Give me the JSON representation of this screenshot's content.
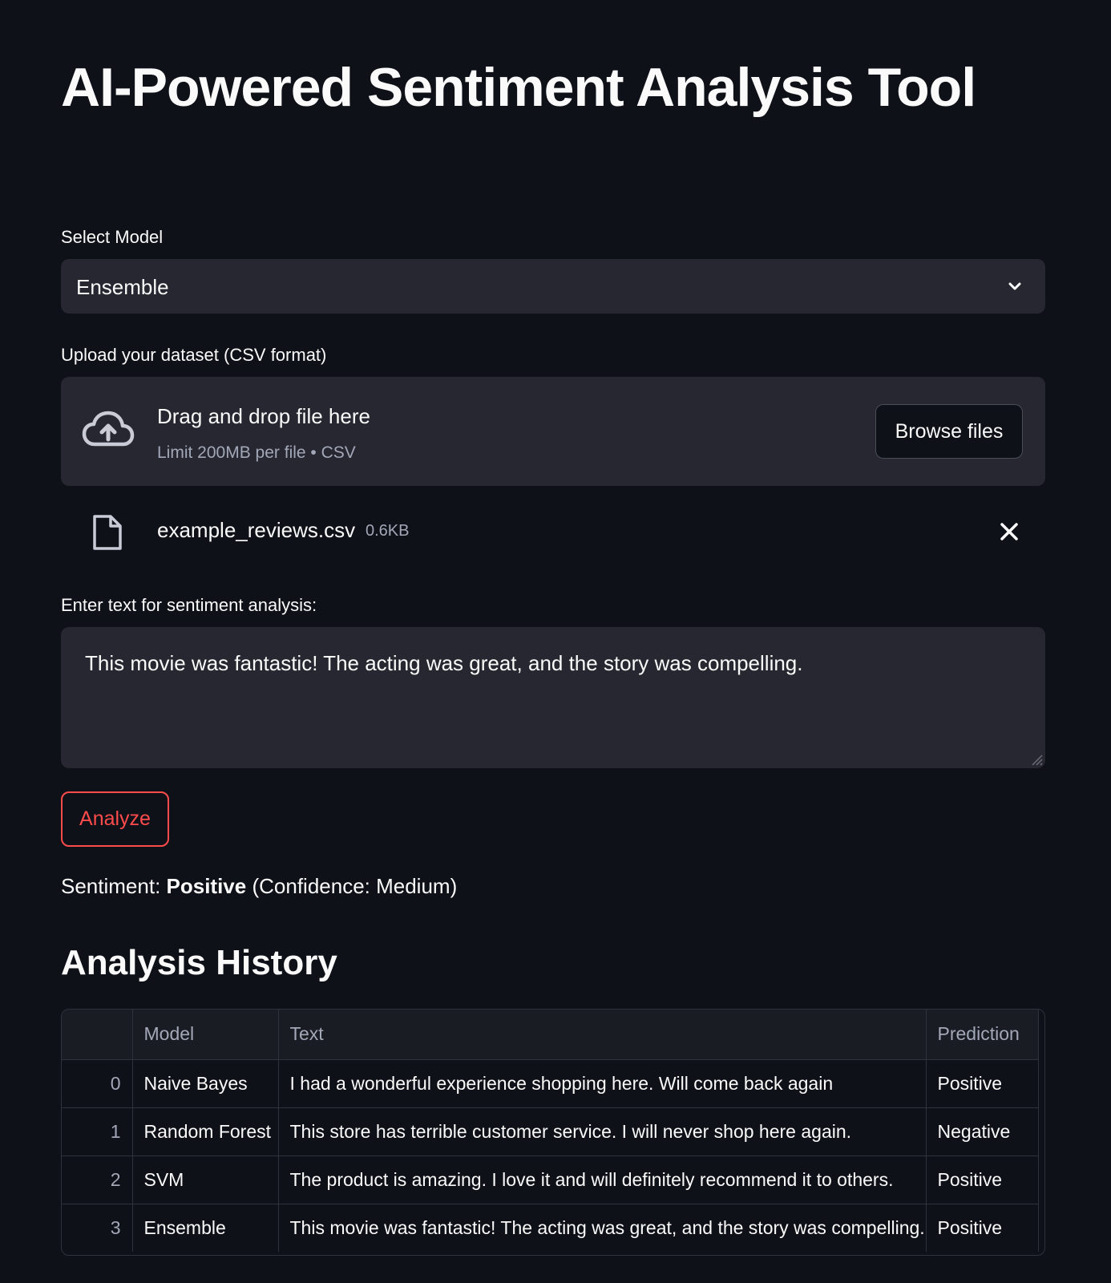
{
  "page_title": "AI-Powered Sentiment Analysis Tool",
  "model_select": {
    "label": "Select Model",
    "value": "Ensemble"
  },
  "uploader": {
    "label": "Upload your dataset (CSV format)",
    "drop_text": "Drag and drop file here",
    "limit_text": "Limit 200MB per file • CSV",
    "browse_label": "Browse files",
    "file_name": "example_reviews.csv",
    "file_size": "0.6KB"
  },
  "text_input": {
    "label": "Enter text for sentiment analysis:",
    "value": "This movie was fantastic! The acting was great, and the story was compelling."
  },
  "analyze_button": "Analyze",
  "result": {
    "prefix": "Sentiment: ",
    "sentiment": "Positive",
    "confidence": " (Confidence: Medium)"
  },
  "history": {
    "title": "Analysis History",
    "columns": [
      "",
      "Model",
      "Text",
      "Prediction"
    ],
    "rows": [
      {
        "index": "0",
        "model": "Naive Bayes",
        "text": "I had a wonderful experience shopping here. Will come back again",
        "prediction": "Positive"
      },
      {
        "index": "1",
        "model": "Random Forest",
        "text": "This store has terrible customer service. I will never shop here again.",
        "prediction": "Negative"
      },
      {
        "index": "2",
        "model": "SVM",
        "text": "The product is amazing. I love it and will definitely recommend it to others.",
        "prediction": "Positive"
      },
      {
        "index": "3",
        "model": "Ensemble",
        "text": "This movie was fantastic! The acting was great, and the story was compelling.",
        "prediction": "Positive"
      }
    ]
  },
  "colors": {
    "background": "#0e1117",
    "widget": "#262730",
    "accent": "#ff4b4b",
    "muted": "#a3a8b8"
  },
  "icons": {
    "upload": "cloud-upload-icon",
    "file": "file-icon",
    "remove": "close-icon",
    "dropdown": "chevron-down-icon"
  }
}
